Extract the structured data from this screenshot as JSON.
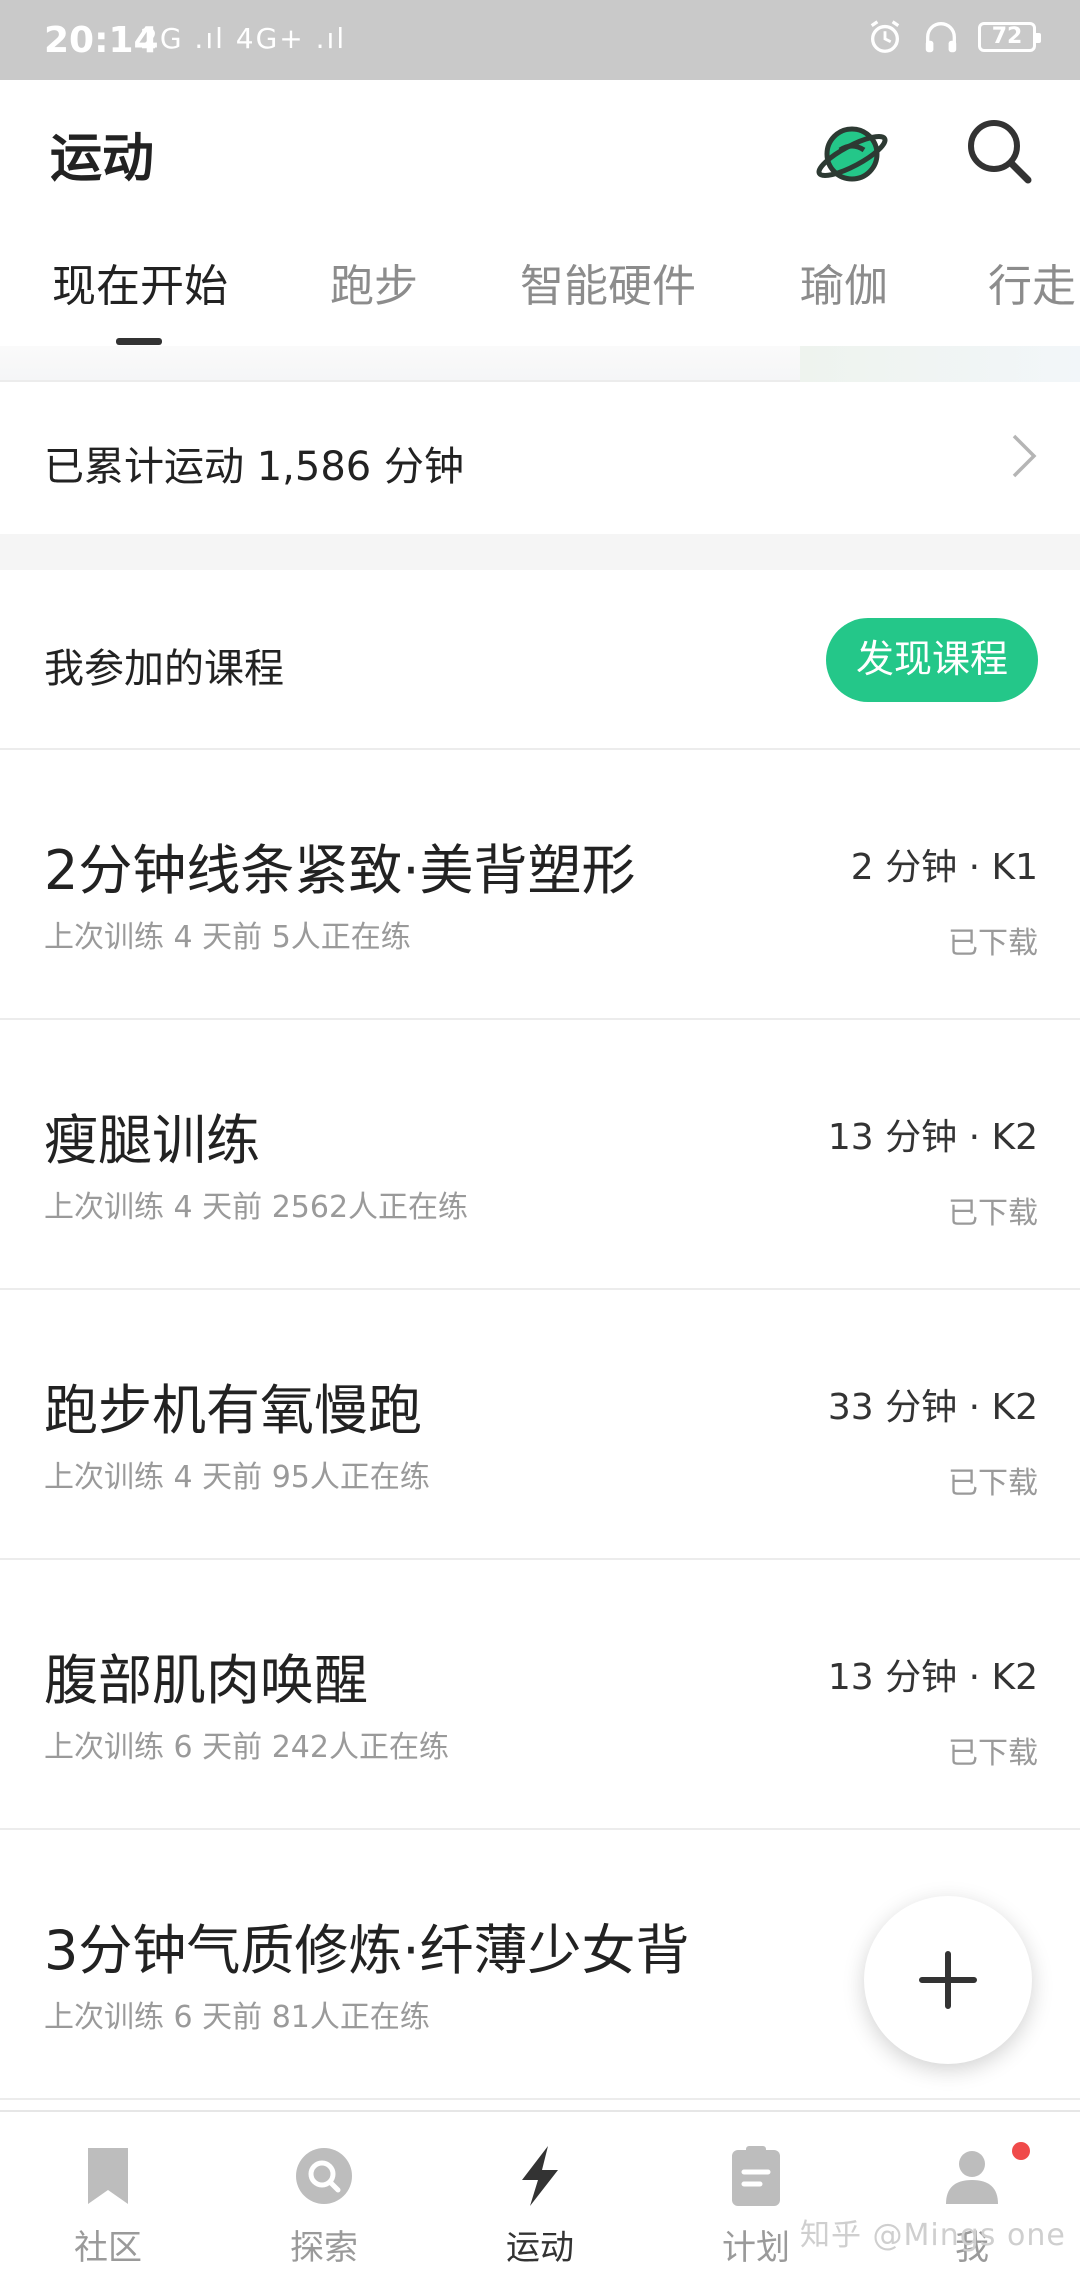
{
  "status_bar": {
    "time": "20:14",
    "signal": "2G .ıl 4G+ .ıl",
    "battery": "72"
  },
  "header": {
    "title": "运动"
  },
  "tabs": [
    "现在开始",
    "跑步",
    "智能硬件",
    "瑜伽",
    "行走"
  ],
  "summary": {
    "text": "已累计运动 1,586 分钟"
  },
  "courses": {
    "title": "我参加的课程",
    "discover_label": "发现课程",
    "items": [
      {
        "title": "2分钟线条紧致·美背塑形",
        "meta": "上次训练 4 天前  5人正在练",
        "duration": "2 分钟 · K1",
        "status": "已下载"
      },
      {
        "title": "瘦腿训练",
        "meta": "上次训练 4 天前  2562人正在练",
        "duration": "13 分钟 · K2",
        "status": "已下载"
      },
      {
        "title": "跑步机有氧慢跑",
        "meta": "上次训练 4 天前  95人正在练",
        "duration": "33 分钟 · K2",
        "status": "已下载"
      },
      {
        "title": "腹部肌肉唤醒",
        "meta": "上次训练 6 天前  242人正在练",
        "duration": "13 分钟 · K2",
        "status": "已下载"
      },
      {
        "title": "3分钟气质修炼·纤薄少女背",
        "meta": "上次训练 6 天前  81人正在练",
        "duration": "",
        "status": ""
      }
    ]
  },
  "bottom_nav": [
    "社区",
    "探索",
    "运动",
    "计划",
    "我"
  ],
  "watermark": "知乎 @Mings one",
  "colors": {
    "accent": "#24c789",
    "notification": "#f04a4a"
  }
}
